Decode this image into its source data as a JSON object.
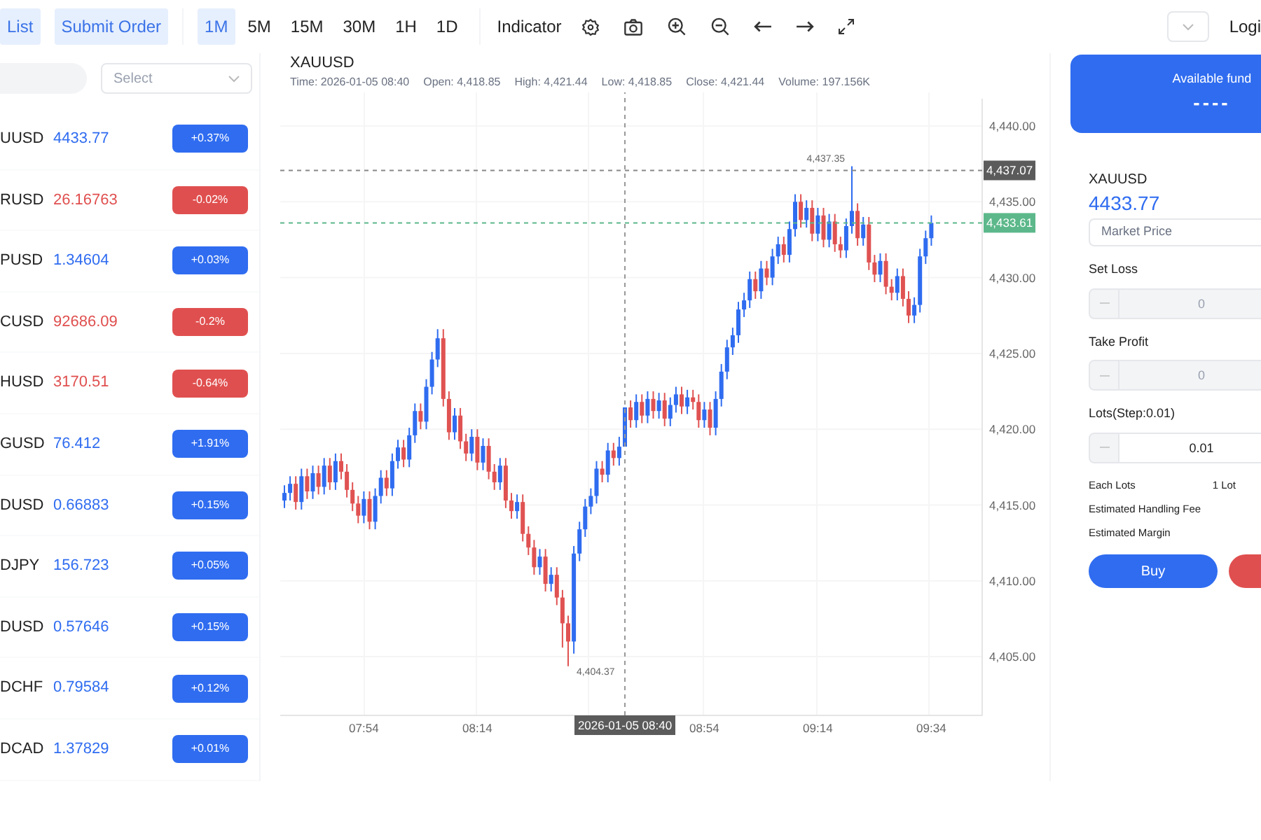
{
  "toolbar": {
    "tabs": [
      {
        "label": "List",
        "selected": true
      },
      {
        "label": "Submit Order",
        "selected": true
      }
    ],
    "timeframes": [
      {
        "label": "1M",
        "selected": true
      },
      {
        "label": "5M",
        "selected": false
      },
      {
        "label": "15M",
        "selected": false
      },
      {
        "label": "30M",
        "selected": false
      },
      {
        "label": "1H",
        "selected": false
      },
      {
        "label": "1D",
        "selected": false
      }
    ],
    "indicator": "Indicator",
    "login": "Logi"
  },
  "watchlist": {
    "select_placeholder": "Select",
    "rows": [
      {
        "symbol": "UUSD",
        "price": "4433.77",
        "change": "+0.37%",
        "color": "#2f6cf0"
      },
      {
        "symbol": "RUSD",
        "price": "26.16763",
        "change": "-0.02%",
        "color": "#e04f4f"
      },
      {
        "symbol": "PUSD",
        "price": "1.34604",
        "change": "+0.03%",
        "color": "#2f6cf0"
      },
      {
        "symbol": "CUSD",
        "price": "92686.09",
        "change": "-0.2%",
        "color": "#e04f4f"
      },
      {
        "symbol": "HUSD",
        "price": "3170.51",
        "change": "-0.64%",
        "color": "#e04f4f"
      },
      {
        "symbol": "GUSD",
        "price": "76.412",
        "change": "+1.91%",
        "color": "#2f6cf0"
      },
      {
        "symbol": "DUSD",
        "price": "0.66883",
        "change": "+0.15%",
        "color": "#2f6cf0"
      },
      {
        "symbol": "DJPY",
        "price": "156.723",
        "change": "+0.05%",
        "color": "#2f6cf0"
      },
      {
        "symbol": "DUSD",
        "price": "0.57646",
        "change": "+0.15%",
        "color": "#2f6cf0"
      },
      {
        "symbol": "DCHF",
        "price": "0.79584",
        "change": "+0.12%",
        "color": "#2f6cf0"
      },
      {
        "symbol": "DCAD",
        "price": "1.37829",
        "change": "+0.01%",
        "color": "#2f6cf0"
      }
    ]
  },
  "chart": {
    "title": "XAUUSD",
    "info": [
      "Time: 2026-01-05 08:40",
      "Open: 4,418.85",
      "High: 4,421.44",
      "Low: 4,418.85",
      "Close: 4,421.44",
      "Volume: 197.156K"
    ],
    "chart_data": {
      "type": "candlestick",
      "yticks": [
        {
          "value": 4440,
          "label": "4,440.00"
        },
        {
          "value": 4435,
          "label": "4,435.00"
        },
        {
          "value": 4430,
          "label": "4,430.00"
        },
        {
          "value": 4425,
          "label": "4,425.00"
        },
        {
          "value": 4420,
          "label": "4,420.00"
        },
        {
          "value": 4415,
          "label": "4,415.00"
        },
        {
          "value": 4410,
          "label": "4,410.00"
        },
        {
          "value": 4405,
          "label": "4,405.00"
        }
      ],
      "ylim": [
        4401.1,
        4441.8
      ],
      "grid": true,
      "ref_lines": [
        {
          "axis": "y",
          "value": 4437.07,
          "label": "4,437.07",
          "color": "#888888"
        },
        {
          "axis": "y",
          "value": 4433.61,
          "label": "4,433.61",
          "color": "#5cb88a"
        },
        {
          "axis": "x",
          "value": "2026-01-05 08:40",
          "color": "#999999"
        }
      ],
      "annotations": [
        "4,437.35",
        "4,404.37"
      ],
      "categories": [
        null,
        null,
        null,
        null,
        null,
        null,
        null,
        null,
        null,
        null,
        null,
        null,
        null,
        null,
        "07:54",
        null,
        null,
        null,
        null,
        null,
        null,
        null,
        null,
        null,
        null,
        null,
        null,
        null,
        null,
        null,
        null,
        null,
        null,
        null,
        "08:14",
        null,
        null,
        null,
        null,
        null,
        null,
        null,
        null,
        null,
        null,
        null,
        null,
        null,
        null,
        null,
        null,
        null,
        null,
        null,
        null,
        null,
        null,
        null,
        null,
        null,
        "2026-01-05 08:40",
        null,
        null,
        null,
        null,
        null,
        null,
        null,
        null,
        null,
        null,
        null,
        null,
        null,
        "08:54",
        null,
        null,
        null,
        null,
        null,
        null,
        null,
        null,
        null,
        null,
        null,
        null,
        null,
        null,
        null,
        null,
        null,
        null,
        null,
        "09:14",
        null,
        null,
        null,
        null,
        null,
        null,
        null,
        null,
        null,
        null,
        null,
        null,
        null,
        null,
        null,
        null,
        null,
        null,
        null,
        "09:34"
      ],
      "ohlc": [
        [
          4415.3,
          4416.3,
          4414.8,
          4415.8
        ],
        [
          4415.8,
          4416.9,
          4415.3,
          4416.4
        ],
        [
          4416.4,
          4416.9,
          4414.7,
          4415.2
        ],
        [
          4415.2,
          4417.4,
          4414.7,
          4416.9
        ],
        [
          4416.9,
          4417.4,
          4415.4,
          4415.9
        ],
        [
          4415.9,
          4417.6,
          4415.4,
          4417.1
        ],
        [
          4417.1,
          4417.6,
          4415.7,
          4416.2
        ],
        [
          4416.2,
          4418.1,
          4415.7,
          4417.6
        ],
        [
          4417.6,
          4418.1,
          4416.0,
          4416.5
        ],
        [
          4416.5,
          4418.4,
          4416.0,
          4417.9
        ],
        [
          4417.9,
          4418.4,
          4416.7,
          4417.2
        ],
        [
          4417.2,
          4417.7,
          4415.5,
          4416.0
        ],
        [
          4416.0,
          4416.5,
          4414.6,
          4415.1
        ],
        [
          4415.1,
          4415.6,
          4413.8,
          4414.3
        ],
        [
          4414.3,
          4415.9,
          4413.8,
          4415.4
        ],
        [
          4415.4,
          4415.9,
          4413.4,
          4413.9
        ],
        [
          4413.9,
          4416.1,
          4413.4,
          4415.6
        ],
        [
          4415.6,
          4417.3,
          4415.1,
          4416.8
        ],
        [
          4416.8,
          4417.3,
          4415.6,
          4416.1
        ],
        [
          4416.1,
          4418.4,
          4415.6,
          4417.9
        ],
        [
          4417.9,
          4419.3,
          4417.4,
          4418.8
        ],
        [
          4418.8,
          4419.3,
          4417.5,
          4418.0
        ],
        [
          4418.0,
          4420.1,
          4417.5,
          4419.6
        ],
        [
          4419.6,
          4421.7,
          4419.1,
          4421.2
        ],
        [
          4421.2,
          4421.7,
          4420.0,
          4420.5
        ],
        [
          4420.5,
          4423.3,
          4420.0,
          4422.8
        ],
        [
          4422.8,
          4425.1,
          4422.3,
          4424.6
        ],
        [
          4424.6,
          4426.6,
          4424.1,
          4426.0
        ],
        [
          4426.0,
          4426.6,
          4421.5,
          4422.0
        ],
        [
          4422.0,
          4422.5,
          4419.3,
          4419.8
        ],
        [
          4419.8,
          4421.4,
          4419.3,
          4420.9
        ],
        [
          4420.9,
          4421.4,
          4418.7,
          4419.2
        ],
        [
          4419.2,
          4419.7,
          4417.9,
          4418.4
        ],
        [
          4418.4,
          4420.0,
          4417.9,
          4419.5
        ],
        [
          4419.5,
          4420.0,
          4417.3,
          4417.8
        ],
        [
          4417.8,
          4419.4,
          4417.3,
          4418.9
        ],
        [
          4418.9,
          4419.4,
          4416.7,
          4417.2
        ],
        [
          4417.2,
          4417.7,
          4416.0,
          4416.5
        ],
        [
          4416.5,
          4418.1,
          4416.0,
          4417.6
        ],
        [
          4417.6,
          4418.1,
          4414.8,
          4415.3
        ],
        [
          4415.3,
          4415.8,
          4414.1,
          4414.6
        ],
        [
          4414.6,
          4415.7,
          4414.1,
          4415.2
        ],
        [
          4415.2,
          4415.7,
          4412.6,
          4413.1
        ],
        [
          4413.1,
          4413.6,
          4411.7,
          4412.2
        ],
        [
          4412.2,
          4412.7,
          4410.4,
          4410.9
        ],
        [
          4410.9,
          4412.1,
          4410.4,
          4411.6
        ],
        [
          4411.6,
          4412.1,
          4409.3,
          4409.8
        ],
        [
          4409.8,
          4410.9,
          4409.3,
          4410.4
        ],
        [
          4410.4,
          4410.9,
          4408.4,
          4408.9
        ],
        [
          4408.9,
          4409.4,
          4405.6,
          4407.2
        ],
        [
          4407.2,
          4407.7,
          4404.37,
          4406.0
        ],
        [
          4406.0,
          4412.3,
          4405.2,
          4411.8
        ],
        [
          4411.8,
          4413.9,
          4411.3,
          4413.4
        ],
        [
          4413.4,
          4415.4,
          4412.9,
          4414.9
        ],
        [
          4414.9,
          4416.1,
          4414.4,
          4415.6
        ],
        [
          4415.6,
          4417.9,
          4415.1,
          4417.4
        ],
        [
          4417.4,
          4417.9,
          4416.5,
          4417.0
        ],
        [
          4417.0,
          4419.1,
          4416.5,
          4418.6
        ],
        [
          4418.6,
          4419.1,
          4417.6,
          4418.1
        ],
        [
          4418.1,
          4419.5,
          4417.6,
          4418.85
        ],
        [
          4418.85,
          4421.44,
          4418.85,
          4421.44
        ],
        [
          4421.44,
          4421.9,
          4420.1,
          4420.6
        ],
        [
          4420.6,
          4422.3,
          4420.1,
          4421.8
        ],
        [
          4421.8,
          4422.3,
          4420.4,
          4420.9
        ],
        [
          4420.9,
          4422.5,
          4420.4,
          4422.0
        ],
        [
          4422.0,
          4422.5,
          4420.7,
          4421.2
        ],
        [
          4421.2,
          4422.4,
          4420.7,
          4421.9
        ],
        [
          4421.9,
          4422.4,
          4420.2,
          4420.7
        ],
        [
          4420.7,
          4422.1,
          4420.2,
          4421.6
        ],
        [
          4421.6,
          4422.8,
          4421.1,
          4422.3
        ],
        [
          4422.3,
          4422.8,
          4421.0,
          4421.5
        ],
        [
          4421.5,
          4422.6,
          4421.0,
          4422.1
        ],
        [
          4422.1,
          4422.6,
          4421.3,
          4421.8
        ],
        [
          4421.8,
          4422.3,
          4420.1,
          4420.6
        ],
        [
          4420.6,
          4421.8,
          4420.1,
          4421.3
        ],
        [
          4421.3,
          4421.8,
          4419.6,
          4420.1
        ],
        [
          4420.1,
          4422.5,
          4419.6,
          4422.0
        ],
        [
          4422.0,
          4424.3,
          4421.5,
          4423.8
        ],
        [
          4423.8,
          4425.9,
          4423.3,
          4425.4
        ],
        [
          4425.4,
          4426.7,
          4424.9,
          4426.2
        ],
        [
          4426.2,
          4428.4,
          4425.7,
          4427.9
        ],
        [
          4427.9,
          4429.0,
          4427.4,
          4428.5
        ],
        [
          4428.5,
          4430.4,
          4428.0,
          4429.9
        ],
        [
          4429.9,
          4430.4,
          4428.6,
          4429.1
        ],
        [
          4429.1,
          4431.1,
          4428.6,
          4430.6
        ],
        [
          4430.6,
          4431.1,
          4429.5,
          4430.0
        ],
        [
          4430.0,
          4431.9,
          4429.5,
          4431.4
        ],
        [
          4431.4,
          4432.7,
          4430.9,
          4432.2
        ],
        [
          4432.2,
          4432.7,
          4431.0,
          4431.5
        ],
        [
          4431.5,
          4433.7,
          4431.0,
          4433.2
        ],
        [
          4433.2,
          4435.5,
          4432.7,
          4435.0
        ],
        [
          4435.0,
          4435.5,
          4433.3,
          4433.8
        ],
        [
          4433.8,
          4435.1,
          4433.3,
          4434.6
        ],
        [
          4434.6,
          4435.1,
          4432.4,
          4432.9
        ],
        [
          4432.9,
          4434.6,
          4432.4,
          4434.1
        ],
        [
          4434.1,
          4434.6,
          4432.0,
          4432.5
        ],
        [
          4432.5,
          4434.2,
          4432.0,
          4433.7
        ],
        [
          4433.7,
          4434.2,
          4431.7,
          4432.2
        ],
        [
          4432.2,
          4432.7,
          4431.3,
          4431.8
        ],
        [
          4431.8,
          4433.9,
          4431.3,
          4433.4
        ],
        [
          4433.4,
          4437.35,
          4432.9,
          4434.4
        ],
        [
          4434.4,
          4434.9,
          4432.1,
          4432.6
        ],
        [
          4432.6,
          4434.0,
          4432.1,
          4433.5
        ],
        [
          4433.5,
          4434.0,
          4430.5,
          4431.0
        ],
        [
          4431.0,
          4431.5,
          4429.7,
          4430.2
        ],
        [
          4430.2,
          4431.6,
          4429.7,
          4431.1
        ],
        [
          4431.1,
          4431.6,
          4428.9,
          4429.4
        ],
        [
          4429.4,
          4429.9,
          4428.5,
          4429.0
        ],
        [
          4429.0,
          4430.6,
          4428.5,
          4430.1
        ],
        [
          4430.1,
          4430.6,
          4428.1,
          4428.6
        ],
        [
          4428.6,
          4429.1,
          4427.0,
          4427.5
        ],
        [
          4427.5,
          4428.7,
          4427.0,
          4428.2
        ],
        [
          4428.2,
          4431.9,
          4427.7,
          4431.4
        ],
        [
          4431.4,
          4433.1,
          4430.9,
          4432.6
        ],
        [
          4432.6,
          4434.1,
          4432.1,
          4433.61
        ]
      ]
    }
  },
  "order_panel": {
    "funds_label": "Available fund",
    "funds_value": "----",
    "symbol": "XAUUSD",
    "price": "4433.77",
    "order_type": "Market Price",
    "fields": [
      {
        "label": "Set Loss",
        "placeholder": "0",
        "disabled": true
      },
      {
        "label": "Take Profit",
        "placeholder": "0",
        "disabled": true
      },
      {
        "label": "Lots(Step:0.01)",
        "value": "0.01",
        "disabled": false
      }
    ],
    "info": [
      {
        "label": "Each Lots",
        "value": "1 Lot"
      },
      {
        "label": "Estimated Handling Fee"
      },
      {
        "label": "Estimated Margin"
      }
    ],
    "buy": "Buy"
  }
}
